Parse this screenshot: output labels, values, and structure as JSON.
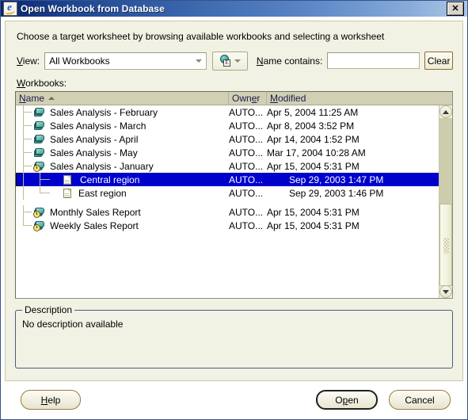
{
  "window": {
    "title": "Open Workbook from Database",
    "icon": "ie-document-icon",
    "close_label": "✕"
  },
  "instruction": "Choose a target worksheet by browsing available workbooks and selecting a worksheet",
  "filter": {
    "view_label": "View:",
    "view_value": "All Workbooks",
    "view_mode_icon": "globe-e-icon",
    "name_contains_label": "Name contains:",
    "name_contains_value": "",
    "name_contains_placeholder": "",
    "clear_label": "Clear"
  },
  "list": {
    "section_label": "Workbooks:",
    "columns": [
      {
        "label": "Name",
        "sort": "asc"
      },
      {
        "label": "Owner",
        "sort": "none"
      },
      {
        "label": "Modified",
        "sort": "none"
      }
    ],
    "rows": [
      {
        "name": "Sales Analysis - February",
        "owner": "AUTO...",
        "modified": "Apr 5, 2004 11:25 AM",
        "icon": "workbook-icon",
        "level": 0,
        "selected": false
      },
      {
        "name": "Sales Analysis - March",
        "owner": "AUTO...",
        "modified": "Apr 8, 2004 3:52 PM",
        "icon": "workbook-icon",
        "level": 0,
        "selected": false
      },
      {
        "name": "Sales Analysis - April",
        "owner": "AUTO...",
        "modified": "Apr 14, 2004 1:52 PM",
        "icon": "workbook-icon",
        "level": 0,
        "selected": false
      },
      {
        "name": "Sales Analysis - May",
        "owner": "AUTO...",
        "modified": "Mar 17, 2004 10:28 AM",
        "icon": "workbook-icon",
        "level": 0,
        "selected": false
      },
      {
        "name": "Sales Analysis - January",
        "owner": "AUTO...",
        "modified": "Apr 15, 2004 5:31 PM",
        "icon": "workbook-scheduled-icon",
        "level": 0,
        "selected": false
      },
      {
        "name": "Central region",
        "owner": "AUTO...",
        "modified": "Sep 29, 2003 1:47 PM",
        "icon": "worksheet-icon",
        "level": 1,
        "selected": true
      },
      {
        "name": "East region",
        "owner": "AUTO...",
        "modified": "Sep 29, 2003 1:46 PM",
        "icon": "worksheet-icon",
        "level": 1,
        "selected": false
      },
      {
        "name": "Monthly Sales Report",
        "owner": "AUTO...",
        "modified": "Apr 15, 2004 5:31 PM",
        "icon": "workbook-scheduled-icon",
        "level": 0,
        "selected": false
      },
      {
        "name": "Weekly Sales Report",
        "owner": "AUTO...",
        "modified": "Apr 15, 2004 5:31 PM",
        "icon": "workbook-scheduled-icon",
        "level": 0,
        "selected": false
      }
    ]
  },
  "description": {
    "legend": "Description",
    "text": "No description available"
  },
  "buttons": {
    "help": "Help",
    "open": "Open",
    "cancel": "Cancel"
  },
  "colors": {
    "titlebar_start": "#0a246a",
    "titlebar_end": "#aec8e6",
    "panel_bg": "#f2f2e4",
    "selection_bg": "#0000cc",
    "selection_fg": "#ffffff",
    "header_bg": "#d2d0b4"
  }
}
